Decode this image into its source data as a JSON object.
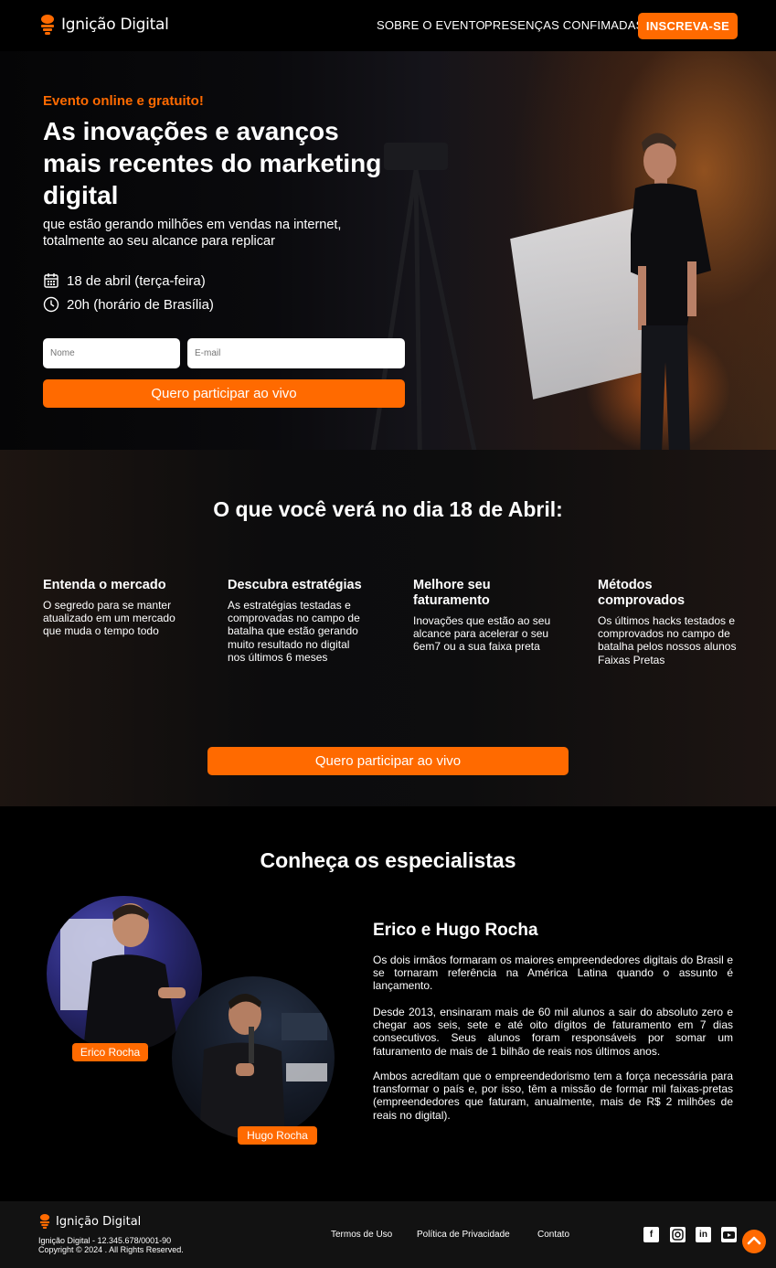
{
  "header": {
    "brand": "Ignição Digital",
    "nav": [
      "SOBRE O EVENTO",
      "PRESENÇAS CONFIMADAS"
    ],
    "cta": "INSCREVA-SE"
  },
  "hero": {
    "tag": "Evento online e gratuito!",
    "title": "As inovações e avanços mais recentes do marketing digital",
    "subtitle": "que estão gerando milhões em vendas na internet, totalmente ao seu alcance para replicar",
    "date": "18 de abril (terça-feira)",
    "time": "20h (horário de Brasília)",
    "name_placeholder": "Nome",
    "email_placeholder": "E-mail",
    "cta": "Quero participar ao vivo"
  },
  "features": {
    "title": "O que você verá no dia 18 de Abril:",
    "items": [
      {
        "title": "Entenda o mercado",
        "text": "O segredo para se manter atualizado em um mercado que muda o tempo todo"
      },
      {
        "title": "Descubra estratégias",
        "text": "As estratégias testadas e comprovadas no campo de batalha que estão gerando muito resultado no digital nos últimos 6 meses"
      },
      {
        "title": "Melhore seu faturamento",
        "text": "Inovações que estão ao seu alcance para acelerar o seu 6em7 ou a sua faixa preta"
      },
      {
        "title": "Métodos comprovados",
        "text": "Os últimos hacks testados e comprovados no campo de batalha pelos nossos alunos Faixas Pretas"
      }
    ],
    "cta": "Quero participar ao vivo"
  },
  "specialists": {
    "title": "Conheça os especialistas",
    "names": [
      "Erico Rocha",
      "Hugo Rocha"
    ],
    "heading": "Erico e Hugo Rocha",
    "paragraphs": [
      "Os dois irmãos formaram os maiores empreendedores digitais do Brasil e se tornaram referência na América Latina quando o assunto é lançamento.",
      "Desde 2013, ensinaram mais de 60 mil alunos a sair do absoluto zero e chegar aos seis, sete e até oito dígitos de faturamento em 7 dias consecutivos. Seus alunos foram responsáveis por somar um faturamento de mais de 1 bilhão de reais nos últimos anos.",
      "Ambos acreditam que o empreendedorismo tem a força necessária para transformar o país e, por isso, têm a missão de formar mil faixas-pretas (empreendedores que faturam, anualmente, mais de R$ 2 milhões de reais no digital)."
    ]
  },
  "footer": {
    "brand": "Ignição Digital",
    "company_line": "Ignição Digital - 12.345.678/0001-90",
    "copyright": "Copyright © 2024 . All Rights Reserved.",
    "links": [
      "Termos de Uso",
      "Política de Privacidade",
      "Contato"
    ],
    "social": [
      "facebook-icon",
      "instagram-icon",
      "linkedin-icon",
      "youtube-icon"
    ]
  },
  "colors": {
    "accent": "#ff6a00",
    "background": "#000000",
    "footer": "#121212"
  }
}
